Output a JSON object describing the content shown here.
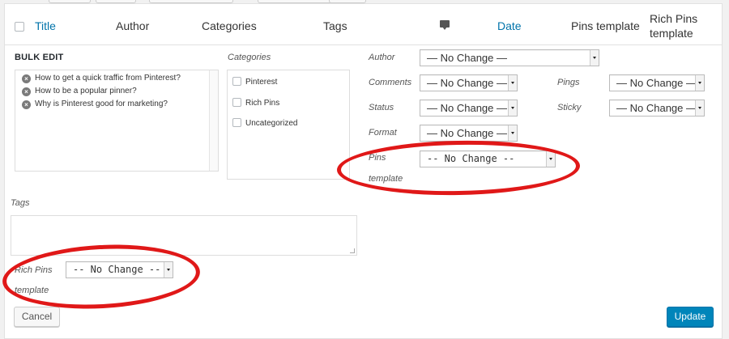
{
  "columns": {
    "title": "Title",
    "author": "Author",
    "categories": "Categories",
    "tags": "Tags",
    "comments_icon": "comment-bubble-icon",
    "date": "Date",
    "pins_template": "Pins template",
    "rich_pins_template_line1": "Rich Pins",
    "rich_pins_template_line2": "template"
  },
  "bulk_edit": {
    "heading": "BULK EDIT",
    "posts": [
      "How to get a quick traffic from Pinterest?",
      "How to be a popular pinner?",
      "Why is Pinterest good for marketing?"
    ],
    "remove_icon": "remove-circle-icon"
  },
  "categories": {
    "label": "Categories",
    "items": [
      "Pinterest",
      "Rich Pins",
      "Uncategorized"
    ]
  },
  "fields": {
    "author": {
      "label": "Author",
      "value": "— No Change —"
    },
    "comments": {
      "label": "Comments",
      "value": "— No Change —"
    },
    "pings": {
      "label": "Pings",
      "value": "— No Change —"
    },
    "status": {
      "label": "Status",
      "value": "— No Change —"
    },
    "sticky": {
      "label": "Sticky",
      "value": "— No Change —"
    },
    "format": {
      "label": "Format",
      "value": "— No Change —"
    },
    "pins_template": {
      "label_line1": "Pins",
      "label_line2": "template",
      "value": "-- No Change --"
    },
    "rich_pins_template": {
      "label_line1": "Rich Pins",
      "label_line2": "template",
      "value": "-- No Change --"
    }
  },
  "tags": {
    "label": "Tags",
    "value": ""
  },
  "buttons": {
    "cancel": "Cancel",
    "update": "Update"
  },
  "colors": {
    "link": "#0073aa",
    "primary_button": "#0085ba",
    "annotation": "#e01818"
  }
}
